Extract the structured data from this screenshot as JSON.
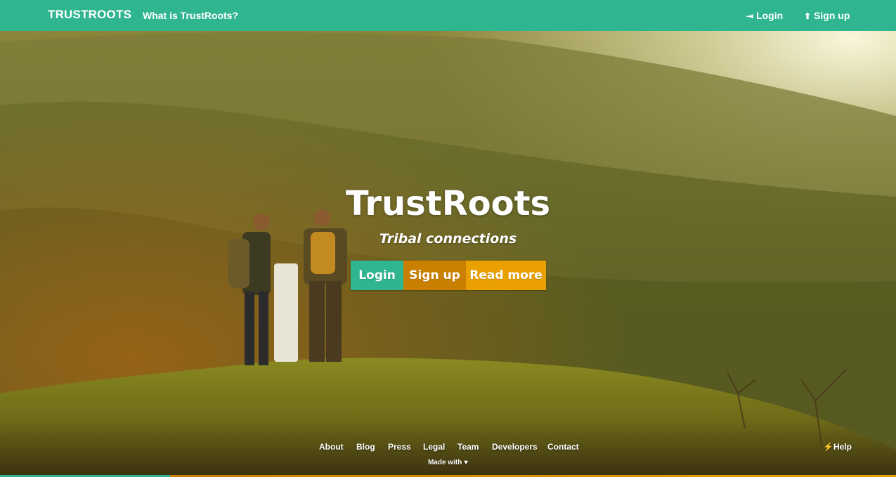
{
  "navbar": {
    "brand": "TRUSTROOTS",
    "what_is": "What is TrustRoots?",
    "login": "Login",
    "signup": "Sign up",
    "login_icon": "sign-in-icon",
    "signup_icon": "arrow-circle-up-icon"
  },
  "hero": {
    "title": "TrustRoots",
    "subtitle": "Tribal connections",
    "buttons": {
      "login": "Login",
      "signup": "Sign up",
      "read_more": "Read more"
    }
  },
  "footer": {
    "links": [
      "About",
      "Blog",
      "Press",
      "Legal",
      "Team",
      "Developers",
      "Contact"
    ],
    "made_with": "Made with",
    "heart_icon": "heart-icon",
    "help": "Help",
    "help_icon": "bolt-icon"
  },
  "colors": {
    "primary": "#2fb58f",
    "signup": "#c97f00",
    "read_more": "#e9a000"
  }
}
